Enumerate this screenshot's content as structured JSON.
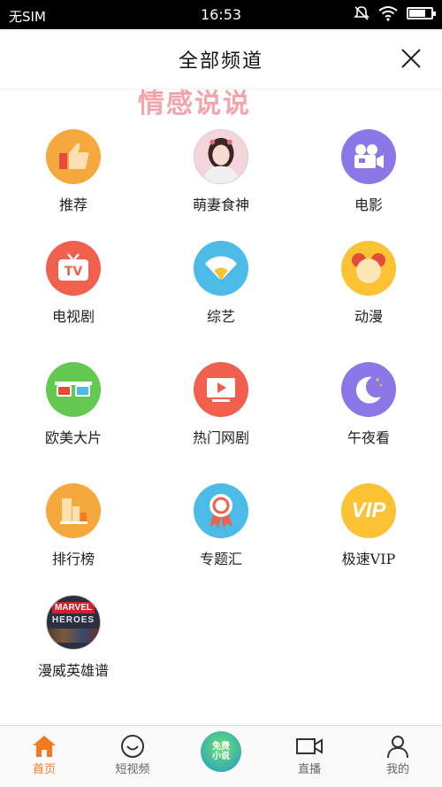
{
  "status": {
    "carrier": "无SIM",
    "time": "16:53"
  },
  "header": {
    "title": "全部频道",
    "close_icon": "close-icon"
  },
  "watermark": "情感说说",
  "channels": [
    {
      "label": "推荐",
      "icon": "thumbs-up-icon",
      "color": "#f5a83e"
    },
    {
      "label": "萌妻食神",
      "icon": "actress-avatar",
      "color": "#f3d6dc"
    },
    {
      "label": "电影",
      "icon": "movie-camera-icon",
      "color": "#8b78e6"
    },
    {
      "label": "电视剧",
      "icon": "tv-icon",
      "color": "#f0604d"
    },
    {
      "label": "综艺",
      "icon": "fan-icon",
      "color": "#4cbbe8"
    },
    {
      "label": "动漫",
      "icon": "cartoon-face-icon",
      "color": "#fbc233"
    },
    {
      "label": "欧美大片",
      "icon": "3d-glasses-icon",
      "color": "#63c950"
    },
    {
      "label": "热门网剧",
      "icon": "play-screen-icon",
      "color": "#f0604d"
    },
    {
      "label": "午夜看",
      "icon": "moon-icon",
      "color": "#8b78e6"
    },
    {
      "label": "排行榜",
      "icon": "bar-chart-icon",
      "color": "#f5a83e"
    },
    {
      "label": "专题汇",
      "icon": "ribbon-badge-icon",
      "color": "#4cbbe8"
    },
    {
      "label": "极速VIP",
      "icon": "vip-icon",
      "color": "#fbc233",
      "badge": "VIP"
    },
    {
      "label": "漫威英雄谱",
      "icon": "marvel-heroes-icon",
      "color": "#2a3042",
      "badge_top": "MARVEL",
      "badge_bottom": "HEROES"
    }
  ],
  "tabbar": {
    "active_color": "#f47a1f",
    "tabs": [
      {
        "label": "首页",
        "icon": "home-icon"
      },
      {
        "label": "短视频",
        "icon": "smile-icon"
      },
      {
        "label": "",
        "icon": "free-novel-icon",
        "badge_line1": "免费",
        "badge_line2": "小说"
      },
      {
        "label": "直播",
        "icon": "video-camera-icon"
      },
      {
        "label": "我的",
        "icon": "user-icon"
      }
    ]
  }
}
